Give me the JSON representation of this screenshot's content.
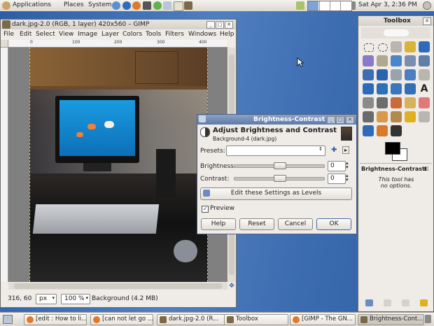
{
  "top_panel": {
    "menus": [
      "Applications",
      "Places",
      "System"
    ],
    "clock": "Sat Apr  3,  2:36 PM"
  },
  "gimp_window": {
    "title": "dark.jpg-2.0 (RGB, 1 layer) 420x560 – GIMP",
    "menu": [
      "File",
      "Edit",
      "Select",
      "View",
      "Image",
      "Layer",
      "Colors",
      "Tools",
      "Filters",
      "Windows",
      "Help"
    ],
    "ruler_h": [
      "0",
      "100",
      "200",
      "300",
      "400"
    ],
    "status": {
      "coords": "316, 60",
      "unit": "px",
      "zoom": "100 %",
      "info": "Background (4.2 MB)"
    }
  },
  "dialog": {
    "title": "Brightness-Contrast",
    "heading": "Adjust Brightness and Contrast",
    "subheading": "Background-4 (dark.jpg)",
    "presets_label": "Presets:",
    "brightness_label": "Brightness:",
    "brightness_value": "0",
    "contrast_label": "Contrast:",
    "contrast_value": "0",
    "levels_button": "Edit these Settings as Levels",
    "preview_label": "Preview",
    "preview_checked": true,
    "buttons": [
      "Help",
      "Reset",
      "Cancel",
      "OK"
    ]
  },
  "toolbox": {
    "title": "Toolbox",
    "options_title": "Brightness-Contrast",
    "options_text": "This tool has\nno options."
  },
  "taskbar": {
    "tasks": [
      "[edit : How to li...",
      "[can not let go ...",
      "dark.jpg-2.0 (R...",
      "Toolbox",
      "[GIMP - The GN...",
      "Brightness-Cont..."
    ],
    "active_index": 5
  },
  "colors": {
    "accent": "#3d6db0",
    "title_active": "#6b86b3",
    "title_inactive": "#d6d2ca"
  }
}
